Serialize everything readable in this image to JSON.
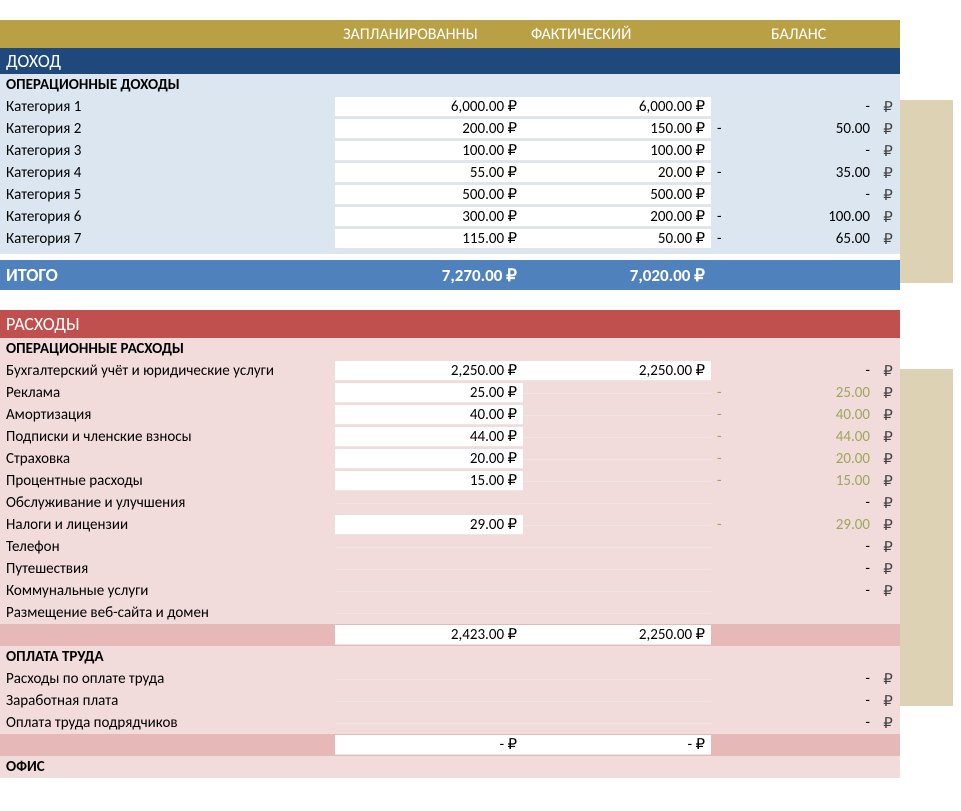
{
  "currency": "₽",
  "headers": {
    "planned": "ЗАПЛАНИРОВАННЫ",
    "actual": "ФАКТИЧЕСКИЙ",
    "balance": "БАЛАНС"
  },
  "income": {
    "band": "ДОХОД",
    "section": "ОПЕРАЦИОННЫЕ ДОХОДЫ",
    "rows": [
      {
        "label": "Категория 1",
        "planned": "6,000.00 ₽",
        "actual": "6,000.00 ₽",
        "sign": "",
        "balance": "-",
        "rub": "₽"
      },
      {
        "label": "Категория 2",
        "planned": "200.00 ₽",
        "actual": "150.00 ₽",
        "sign": "-",
        "balance": "50.00",
        "rub": "₽"
      },
      {
        "label": "Категория 3",
        "planned": "100.00 ₽",
        "actual": "100.00 ₽",
        "sign": "",
        "balance": "-",
        "rub": "₽"
      },
      {
        "label": "Категория 4",
        "planned": "55.00 ₽",
        "actual": "20.00 ₽",
        "sign": "-",
        "balance": "35.00",
        "rub": "₽"
      },
      {
        "label": "Категория 5",
        "planned": "500.00 ₽",
        "actual": "500.00 ₽",
        "sign": "",
        "balance": "-",
        "rub": "₽"
      },
      {
        "label": "Категория 6",
        "planned": "300.00 ₽",
        "actual": "200.00 ₽",
        "sign": "-",
        "balance": "100.00",
        "rub": "₽"
      },
      {
        "label": "Категория 7",
        "planned": "115.00 ₽",
        "actual": "50.00 ₽",
        "sign": "-",
        "balance": "65.00",
        "rub": "₽"
      }
    ],
    "total": {
      "label": "ИТОГО",
      "planned": "7,270.00 ₽",
      "actual": "7,020.00 ₽"
    }
  },
  "expenses": {
    "band": "РАСХОДЫ",
    "sections": [
      {
        "title": "ОПЕРАЦИОННЫЕ РАСХОДЫ",
        "rows": [
          {
            "label": "Бухгалтерский учёт и юридические услуги",
            "planned": "2,250.00 ₽",
            "actual": "2,250.00 ₽",
            "sign": "",
            "balance": "-",
            "rub": "₽",
            "olive": false
          },
          {
            "label": "Реклама",
            "planned": "25.00 ₽",
            "actual": "",
            "sign": "-",
            "balance": "25.00",
            "rub": "₽",
            "olive": true
          },
          {
            "label": "Амортизация",
            "planned": "40.00 ₽",
            "actual": "",
            "sign": "-",
            "balance": "40.00",
            "rub": "₽",
            "olive": true
          },
          {
            "label": "Подписки и членские взносы",
            "planned": "44.00 ₽",
            "actual": "",
            "sign": "-",
            "balance": "44.00",
            "rub": "₽",
            "olive": true
          },
          {
            "label": "Страховка",
            "planned": "20.00 ₽",
            "actual": "",
            "sign": "-",
            "balance": "20.00",
            "rub": "₽",
            "olive": true
          },
          {
            "label": "Процентные расходы",
            "planned": "15.00 ₽",
            "actual": "",
            "sign": "-",
            "balance": "15.00",
            "rub": "₽",
            "olive": true
          },
          {
            "label": "Обслуживание и улучшения",
            "planned": "",
            "actual": "",
            "sign": "",
            "balance": "-",
            "rub": "₽",
            "olive": false
          },
          {
            "label": "Налоги и лицензии",
            "planned": "29.00 ₽",
            "actual": "",
            "sign": "-",
            "balance": "29.00",
            "rub": "₽",
            "olive": true
          },
          {
            "label": "Телефон",
            "planned": "",
            "actual": "",
            "sign": "",
            "balance": "-",
            "rub": "₽",
            "olive": false
          },
          {
            "label": "Путешествия",
            "planned": "",
            "actual": "",
            "sign": "",
            "balance": "-",
            "rub": "₽",
            "olive": false
          },
          {
            "label": "Коммунальные услуги",
            "planned": "",
            "actual": "",
            "sign": "",
            "balance": "-",
            "rub": "₽",
            "olive": false
          },
          {
            "label": "Размещение веб-сайта и домен",
            "planned": "",
            "actual": "",
            "sign": "",
            "balance": "",
            "rub": "",
            "olive": false
          }
        ],
        "subtotal": {
          "planned": "2,423.00 ₽",
          "actual": "2,250.00 ₽"
        }
      },
      {
        "title": "ОПЛАТА ТРУДА",
        "rows": [
          {
            "label": "Расходы по оплате труда",
            "planned": "",
            "actual": "",
            "sign": "",
            "balance": "-",
            "rub": "₽",
            "olive": false
          },
          {
            "label": "Заработная плата",
            "planned": "",
            "actual": "",
            "sign": "",
            "balance": "-",
            "rub": "₽",
            "olive": false
          },
          {
            "label": "Оплата труда подрядчиков",
            "planned": "",
            "actual": "",
            "sign": "",
            "balance": "-",
            "rub": "₽",
            "olive": false
          }
        ],
        "subtotal": {
          "planned": "-   ₽",
          "actual": "-   ₽"
        }
      },
      {
        "title": "ОФИС",
        "rows": [],
        "subtotal": null
      }
    ]
  }
}
